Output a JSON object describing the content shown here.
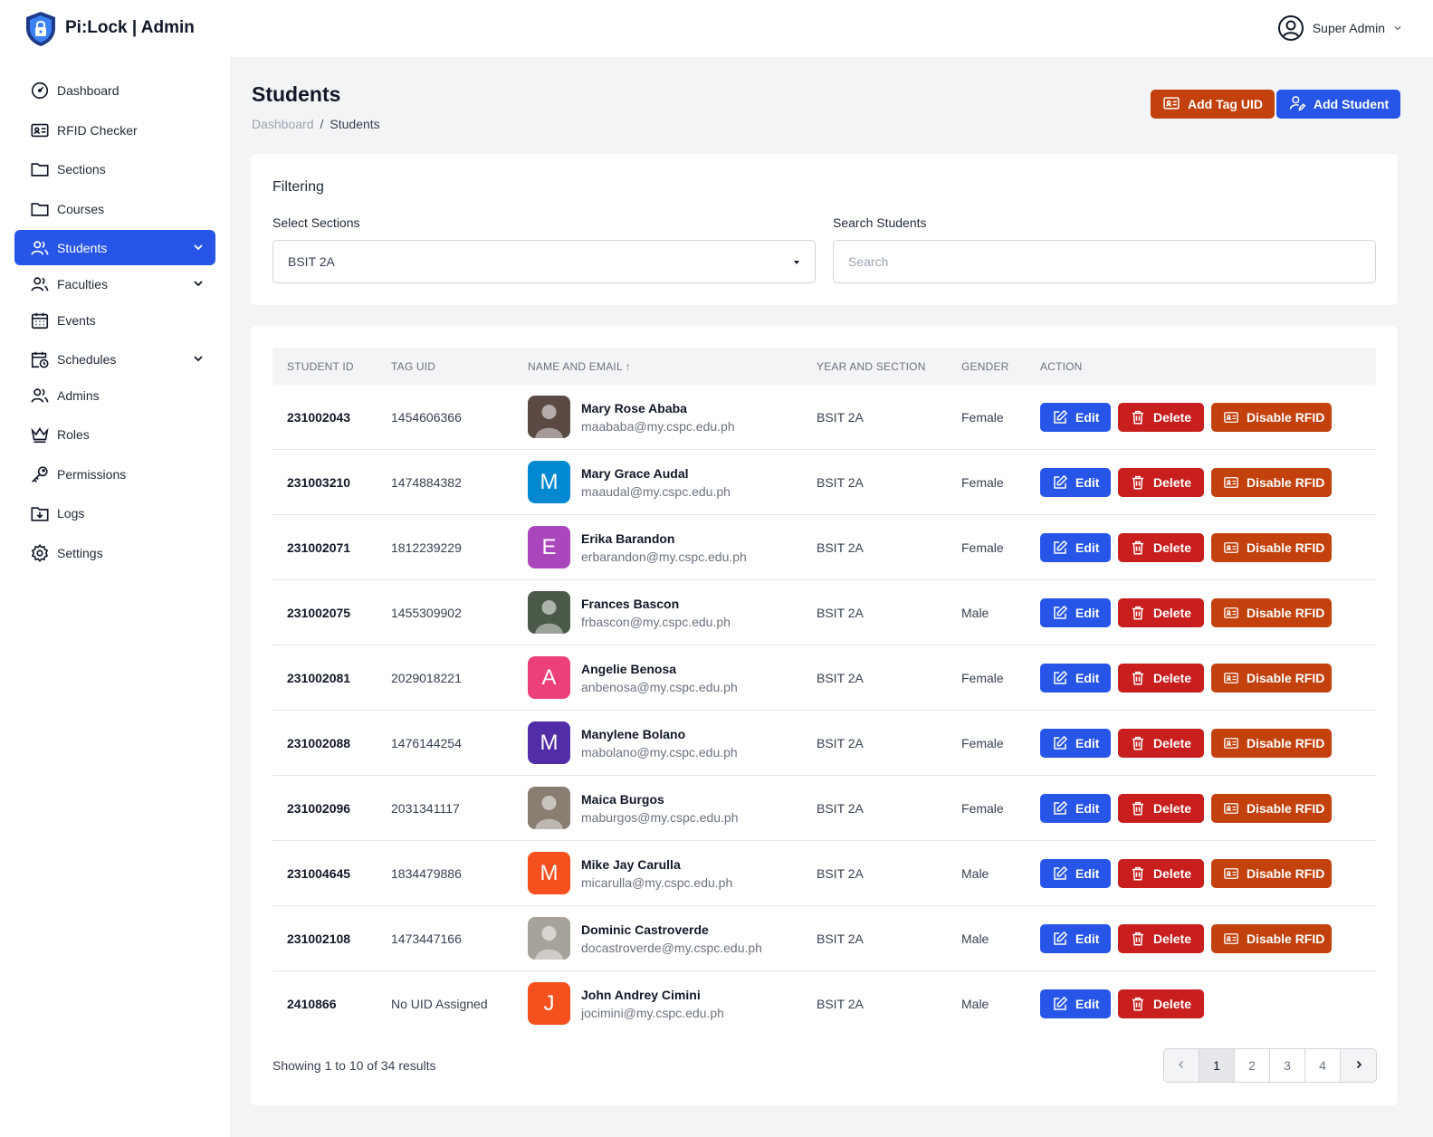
{
  "app": {
    "brand": "Pi:Lock | Admin",
    "user_name": "Super Admin"
  },
  "sidebar": {
    "items": [
      {
        "label": "Dashboard",
        "icon": "dashboard-gauge-icon"
      },
      {
        "label": "RFID Checker",
        "icon": "id-card-icon"
      },
      {
        "label": "Sections",
        "icon": "folder-icon"
      },
      {
        "label": "Courses",
        "icon": "folder-icon"
      },
      {
        "label": "Students",
        "icon": "users-icon",
        "active": true,
        "expandable": true
      },
      {
        "label": "Faculties",
        "icon": "users-icon",
        "expandable": true
      },
      {
        "label": "Events",
        "icon": "calendar-icon"
      },
      {
        "label": "Schedules",
        "icon": "calendar-clock-icon",
        "expandable": true
      },
      {
        "label": "Admins",
        "icon": "users-icon"
      },
      {
        "label": "Roles",
        "icon": "crown-icon"
      },
      {
        "label": "Permissions",
        "icon": "key-icon"
      },
      {
        "label": "Logs",
        "icon": "folder-download-icon"
      },
      {
        "label": "Settings",
        "icon": "gear-icon"
      }
    ]
  },
  "page": {
    "title": "Students",
    "breadcrumb": {
      "home": "Dashboard",
      "separator": "/",
      "current": "Students"
    },
    "add_tag_label": "Add Tag UID",
    "add_student_label": "Add Student"
  },
  "filter": {
    "title": "Filtering",
    "section_label": "Select Sections",
    "section_value": "BSIT 2A",
    "search_label": "Search Students",
    "search_placeholder": "Search"
  },
  "table": {
    "columns": [
      "STUDENT ID",
      "TAG UID",
      "NAME AND EMAIL ↑",
      "YEAR AND SECTION",
      "GENDER",
      "ACTION"
    ],
    "rows": [
      {
        "id": "231002043",
        "uid": "1454606366",
        "name": "Mary Rose Ababa",
        "email": "maababa@my.cspc.edu.ph",
        "section": "BSIT 2A",
        "gender": "Female",
        "avatar": {
          "type": "photo",
          "color": "#5b4a44"
        },
        "rfid": true
      },
      {
        "id": "231003210",
        "uid": "1474884382",
        "name": "Mary Grace Audal",
        "email": "maaudal@my.cspc.edu.ph",
        "section": "BSIT 2A",
        "gender": "Female",
        "avatar": {
          "type": "letter",
          "letter": "M",
          "color": "#0288d1"
        },
        "rfid": true
      },
      {
        "id": "231002071",
        "uid": "1812239229",
        "name": "Erika Barandon",
        "email": "erbarandon@my.cspc.edu.ph",
        "section": "BSIT 2A",
        "gender": "Female",
        "avatar": {
          "type": "letter",
          "letter": "E",
          "color": "#ab47bc"
        },
        "rfid": true
      },
      {
        "id": "231002075",
        "uid": "1455309902",
        "name": "Frances Bascon",
        "email": "frbascon@my.cspc.edu.ph",
        "section": "BSIT 2A",
        "gender": "Male",
        "avatar": {
          "type": "photo",
          "color": "#4b5a48"
        },
        "rfid": true
      },
      {
        "id": "231002081",
        "uid": "2029018221",
        "name": "Angelie Benosa",
        "email": "anbenosa@my.cspc.edu.ph",
        "section": "BSIT 2A",
        "gender": "Female",
        "avatar": {
          "type": "letter",
          "letter": "A",
          "color": "#ec407a"
        },
        "rfid": true
      },
      {
        "id": "231002088",
        "uid": "1476144254",
        "name": "Manylene Bolano",
        "email": "mabolano@my.cspc.edu.ph",
        "section": "BSIT 2A",
        "gender": "Female",
        "avatar": {
          "type": "letter",
          "letter": "M",
          "color": "#512da8"
        },
        "rfid": true
      },
      {
        "id": "231002096",
        "uid": "2031341117",
        "name": "Maica Burgos",
        "email": "maburgos@my.cspc.edu.ph",
        "section": "BSIT 2A",
        "gender": "Female",
        "avatar": {
          "type": "photo",
          "color": "#8a7d72"
        },
        "rfid": true
      },
      {
        "id": "231004645",
        "uid": "1834479886",
        "name": "Mike Jay Carulla",
        "email": "micarulla@my.cspc.edu.ph",
        "section": "BSIT 2A",
        "gender": "Male",
        "avatar": {
          "type": "letter",
          "letter": "M",
          "color": "#f4511e"
        },
        "rfid": true
      },
      {
        "id": "231002108",
        "uid": "1473447166",
        "name": "Dominic Castroverde",
        "email": "docastroverde@my.cspc.edu.ph",
        "section": "BSIT 2A",
        "gender": "Male",
        "avatar": {
          "type": "photo",
          "color": "#a8a39a"
        },
        "rfid": true
      },
      {
        "id": "2410866",
        "uid": "No UID Assigned",
        "name": "John Andrey Cimini",
        "email": "jocimini@my.cspc.edu.ph",
        "section": "BSIT 2A",
        "gender": "Male",
        "avatar": {
          "type": "letter",
          "letter": "J",
          "color": "#f4511e"
        },
        "rfid": false
      }
    ],
    "actions": {
      "edit": "Edit",
      "delete": "Delete",
      "disable_rfid": "Disable RFID"
    }
  },
  "pagination": {
    "summary": "Showing 1 to 10 of 34 results",
    "pages": [
      "1",
      "2",
      "3",
      "4"
    ],
    "current": "1"
  },
  "colors": {
    "primary": "#2755e8",
    "danger": "#c81e1e",
    "warning": "#c2410c",
    "background": "#f3f4f6"
  }
}
